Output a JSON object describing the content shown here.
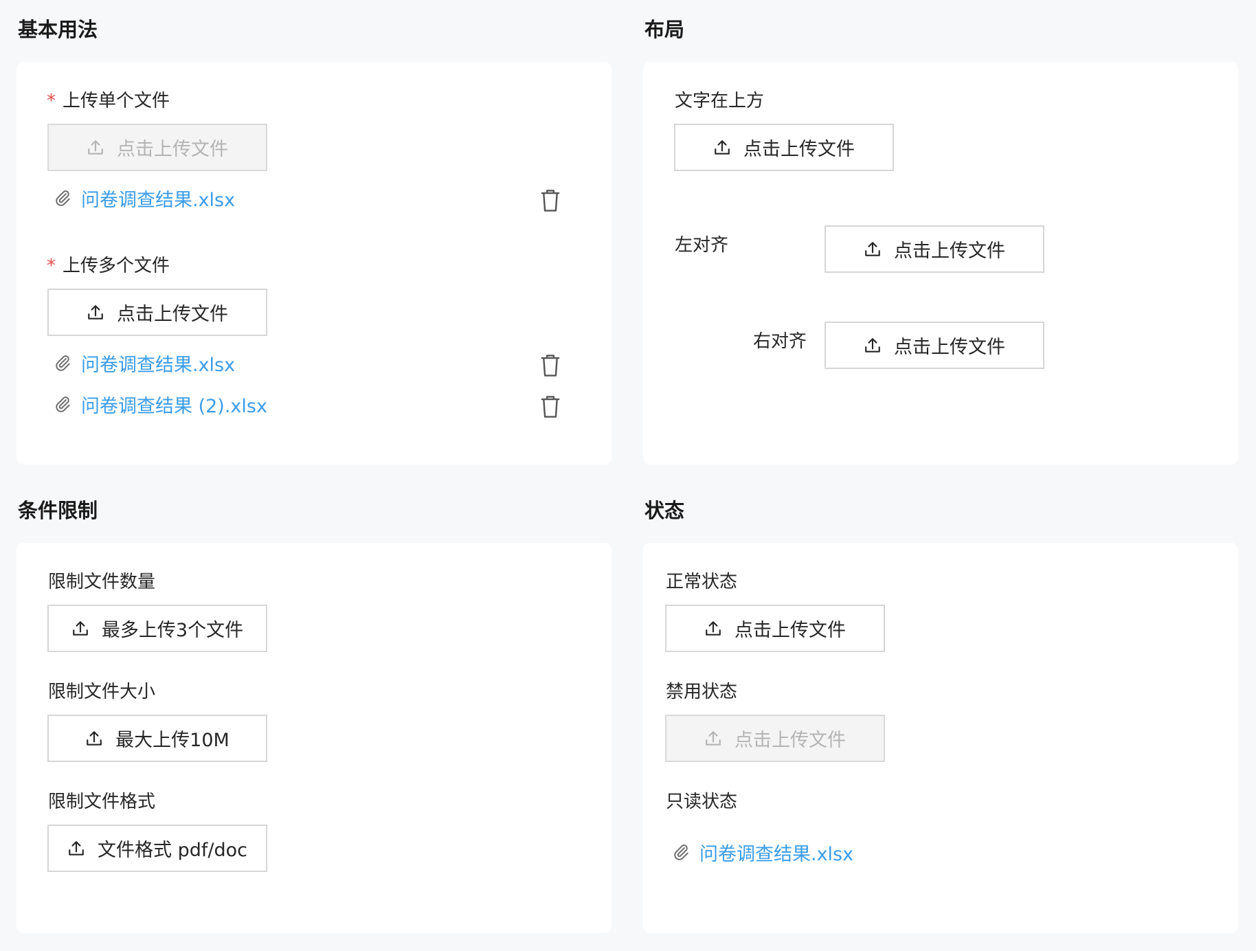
{
  "sections": {
    "basic": {
      "title": "基本用法",
      "single_label": "上传单个文件",
      "single_button": "点击上传文件",
      "single_files": [
        "问卷调查结果.xlsx"
      ],
      "multi_label": "上传多个文件",
      "multi_button": "点击上传文件",
      "multi_files": [
        "问卷调查结果.xlsx",
        "问卷调查结果 (2).xlsx"
      ],
      "required_mark": "*"
    },
    "layout": {
      "title": "布局",
      "top_label": "文字在上方",
      "top_button": "点击上传文件",
      "left_label": "左对齐",
      "left_button": "点击上传文件",
      "right_label": "右对齐",
      "right_button": "点击上传文件"
    },
    "limits": {
      "title": "条件限制",
      "count_label": "限制文件数量",
      "count_button": "最多上传3个文件",
      "size_label": "限制文件大小",
      "size_button": "最大上传10M",
      "format_label": "限制文件格式",
      "format_button": "文件格式 pdf/doc"
    },
    "status": {
      "title": "状态",
      "normal_label": "正常状态",
      "normal_button": "点击上传文件",
      "disabled_label": "禁用状态",
      "disabled_button": "点击上传文件",
      "readonly_label": "只读状态",
      "readonly_files": [
        "问卷调查结果.xlsx"
      ]
    }
  },
  "colors": {
    "link": "#3a9ce8",
    "required": "#e34d4d",
    "border": "#d6d6d6",
    "disabled_bg": "#f4f4f4",
    "page_bg": "#f7f8fa"
  },
  "icons": {
    "upload": "upload-icon",
    "attachment": "paperclip-icon",
    "delete": "trash-icon"
  }
}
